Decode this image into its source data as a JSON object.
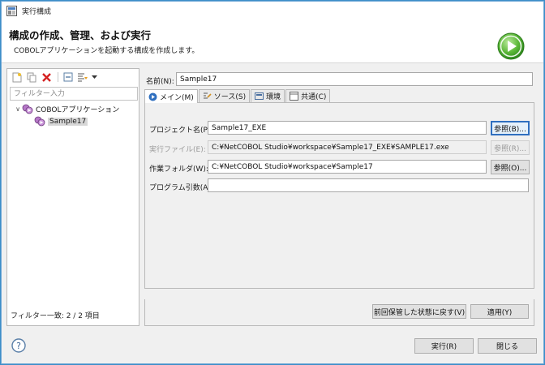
{
  "window": {
    "title": "実行構成"
  },
  "header": {
    "heading": "構成の作成、管理、および実行",
    "subheading": "COBOLアプリケーションを起動する構成を作成します。"
  },
  "left_panel": {
    "filter_placeholder": "フィルター入力",
    "tree": {
      "category_label": "COBOLアプリケーション",
      "item_label": "Sample17"
    },
    "filter_status": "フィルター一致: 2 / 2 項目"
  },
  "config": {
    "name_label": "名前(N):",
    "name_value": "Sample17",
    "tabs": [
      {
        "label": "メイン(M)"
      },
      {
        "label": "ソース(S)"
      },
      {
        "label": "環境"
      },
      {
        "label": "共通(C)"
      }
    ],
    "fields": {
      "project_label": "プロジェクト名(P):",
      "project_value": "Sample17_EXE",
      "exec_label": "実行ファイル(E):",
      "exec_value": "C:¥NetCOBOL Studio¥workspace¥Sample17_EXE¥SAMPLE17.exe",
      "workdir_label": "作業フォルダ(W):",
      "workdir_value": "C:¥NetCOBOL Studio¥workspace¥Sample17",
      "args_label": "プログラム引数(A):",
      "args_value": ""
    },
    "browse_buttons": {
      "project": "参照(B)...",
      "exec": "参照(R)...",
      "workdir": "参照(O)..."
    },
    "revert_button": "前回保管した状態に戻す(V)",
    "apply_button": "適用(Y)"
  },
  "footer": {
    "run_button": "実行(R)",
    "close_button": "閉じる"
  },
  "colors": {
    "run_icon": "#5bb738",
    "window_border": "#6fa7d6",
    "focus": "#2f6fbf"
  }
}
